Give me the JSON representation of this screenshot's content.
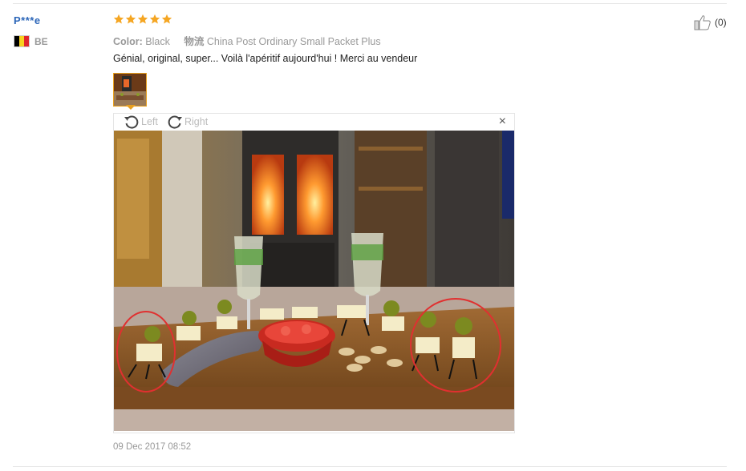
{
  "review": {
    "user_name": "P***e",
    "country_code": "BE",
    "flag_colors": [
      "#000000",
      "#f7d21f",
      "#e0262c"
    ],
    "rating": 5,
    "star_color": "#f5a623",
    "color_label": "Color:",
    "color_value": "Black",
    "shipping_label": "物流",
    "shipping_value": "China Post Ordinary Small Packet Plus",
    "text": "Génial, original, super... Voilà l'apéritif aujourd'hui ! Merci au vendeur",
    "likes": "(0)",
    "date": "09 Dec 2017 08:52"
  },
  "viewer": {
    "rotate_left_label": "Left",
    "rotate_right_label": "Right",
    "close_glyph": "×"
  }
}
